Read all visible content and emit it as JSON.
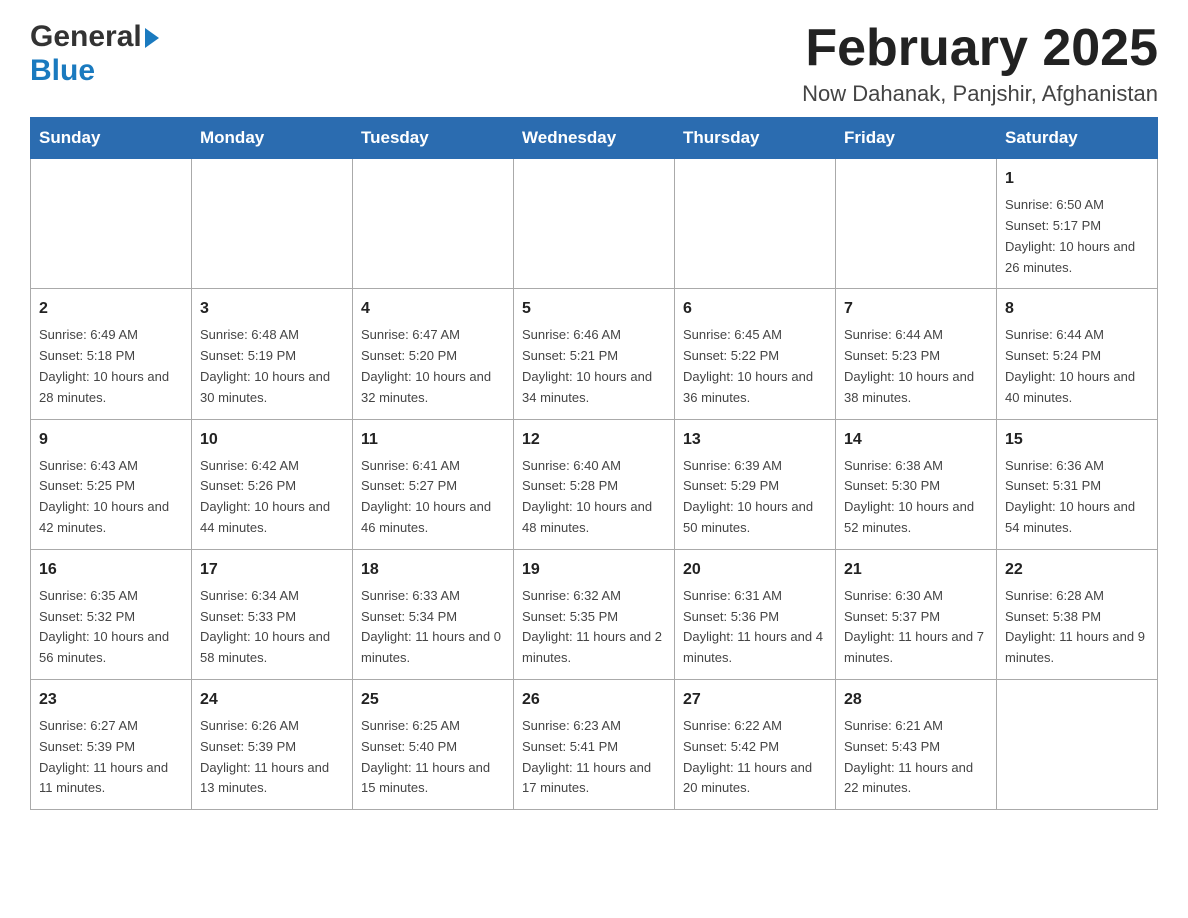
{
  "header": {
    "logo_general": "General",
    "logo_blue": "Blue",
    "title": "February 2025",
    "subtitle": "Now Dahanak, Panjshir, Afghanistan"
  },
  "days_of_week": [
    "Sunday",
    "Monday",
    "Tuesday",
    "Wednesday",
    "Thursday",
    "Friday",
    "Saturday"
  ],
  "weeks": [
    [
      {
        "day": "",
        "info": ""
      },
      {
        "day": "",
        "info": ""
      },
      {
        "day": "",
        "info": ""
      },
      {
        "day": "",
        "info": ""
      },
      {
        "day": "",
        "info": ""
      },
      {
        "day": "",
        "info": ""
      },
      {
        "day": "1",
        "info": "Sunrise: 6:50 AM\nSunset: 5:17 PM\nDaylight: 10 hours and 26 minutes."
      }
    ],
    [
      {
        "day": "2",
        "info": "Sunrise: 6:49 AM\nSunset: 5:18 PM\nDaylight: 10 hours and 28 minutes."
      },
      {
        "day": "3",
        "info": "Sunrise: 6:48 AM\nSunset: 5:19 PM\nDaylight: 10 hours and 30 minutes."
      },
      {
        "day": "4",
        "info": "Sunrise: 6:47 AM\nSunset: 5:20 PM\nDaylight: 10 hours and 32 minutes."
      },
      {
        "day": "5",
        "info": "Sunrise: 6:46 AM\nSunset: 5:21 PM\nDaylight: 10 hours and 34 minutes."
      },
      {
        "day": "6",
        "info": "Sunrise: 6:45 AM\nSunset: 5:22 PM\nDaylight: 10 hours and 36 minutes."
      },
      {
        "day": "7",
        "info": "Sunrise: 6:44 AM\nSunset: 5:23 PM\nDaylight: 10 hours and 38 minutes."
      },
      {
        "day": "8",
        "info": "Sunrise: 6:44 AM\nSunset: 5:24 PM\nDaylight: 10 hours and 40 minutes."
      }
    ],
    [
      {
        "day": "9",
        "info": "Sunrise: 6:43 AM\nSunset: 5:25 PM\nDaylight: 10 hours and 42 minutes."
      },
      {
        "day": "10",
        "info": "Sunrise: 6:42 AM\nSunset: 5:26 PM\nDaylight: 10 hours and 44 minutes."
      },
      {
        "day": "11",
        "info": "Sunrise: 6:41 AM\nSunset: 5:27 PM\nDaylight: 10 hours and 46 minutes."
      },
      {
        "day": "12",
        "info": "Sunrise: 6:40 AM\nSunset: 5:28 PM\nDaylight: 10 hours and 48 minutes."
      },
      {
        "day": "13",
        "info": "Sunrise: 6:39 AM\nSunset: 5:29 PM\nDaylight: 10 hours and 50 minutes."
      },
      {
        "day": "14",
        "info": "Sunrise: 6:38 AM\nSunset: 5:30 PM\nDaylight: 10 hours and 52 minutes."
      },
      {
        "day": "15",
        "info": "Sunrise: 6:36 AM\nSunset: 5:31 PM\nDaylight: 10 hours and 54 minutes."
      }
    ],
    [
      {
        "day": "16",
        "info": "Sunrise: 6:35 AM\nSunset: 5:32 PM\nDaylight: 10 hours and 56 minutes."
      },
      {
        "day": "17",
        "info": "Sunrise: 6:34 AM\nSunset: 5:33 PM\nDaylight: 10 hours and 58 minutes."
      },
      {
        "day": "18",
        "info": "Sunrise: 6:33 AM\nSunset: 5:34 PM\nDaylight: 11 hours and 0 minutes."
      },
      {
        "day": "19",
        "info": "Sunrise: 6:32 AM\nSunset: 5:35 PM\nDaylight: 11 hours and 2 minutes."
      },
      {
        "day": "20",
        "info": "Sunrise: 6:31 AM\nSunset: 5:36 PM\nDaylight: 11 hours and 4 minutes."
      },
      {
        "day": "21",
        "info": "Sunrise: 6:30 AM\nSunset: 5:37 PM\nDaylight: 11 hours and 7 minutes."
      },
      {
        "day": "22",
        "info": "Sunrise: 6:28 AM\nSunset: 5:38 PM\nDaylight: 11 hours and 9 minutes."
      }
    ],
    [
      {
        "day": "23",
        "info": "Sunrise: 6:27 AM\nSunset: 5:39 PM\nDaylight: 11 hours and 11 minutes."
      },
      {
        "day": "24",
        "info": "Sunrise: 6:26 AM\nSunset: 5:39 PM\nDaylight: 11 hours and 13 minutes."
      },
      {
        "day": "25",
        "info": "Sunrise: 6:25 AM\nSunset: 5:40 PM\nDaylight: 11 hours and 15 minutes."
      },
      {
        "day": "26",
        "info": "Sunrise: 6:23 AM\nSunset: 5:41 PM\nDaylight: 11 hours and 17 minutes."
      },
      {
        "day": "27",
        "info": "Sunrise: 6:22 AM\nSunset: 5:42 PM\nDaylight: 11 hours and 20 minutes."
      },
      {
        "day": "28",
        "info": "Sunrise: 6:21 AM\nSunset: 5:43 PM\nDaylight: 11 hours and 22 minutes."
      },
      {
        "day": "",
        "info": ""
      }
    ]
  ]
}
